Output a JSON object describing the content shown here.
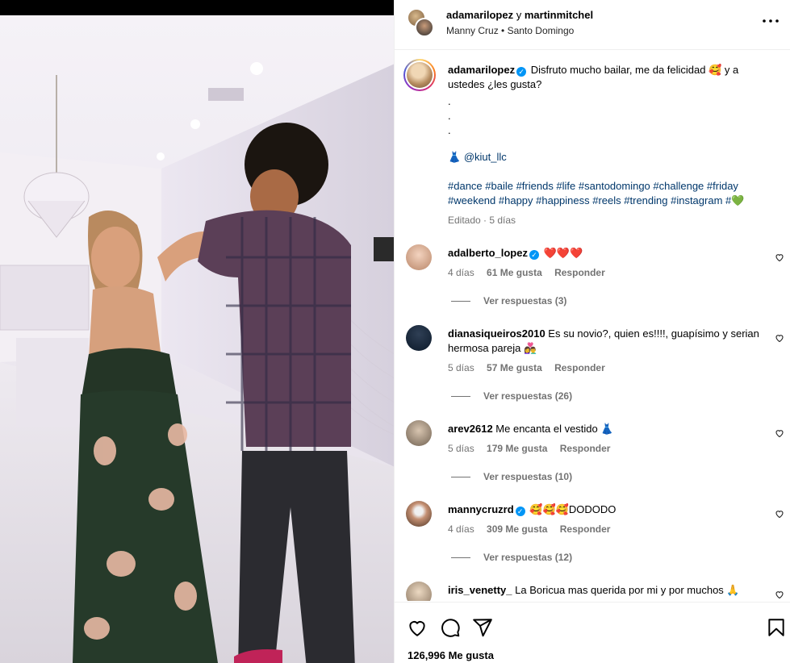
{
  "header": {
    "user1": "adamarilopez",
    "joiner": "y",
    "user2": "martinmitchel",
    "audio": "Manny Cruz",
    "separator": "•",
    "location": "Santo Domingo"
  },
  "caption": {
    "username": "adamarilopez",
    "text": "Disfruto mucho bailar, me da felicidad 🥰 y a ustedes ¿les gusta?",
    "dots": [
      ".",
      ".",
      "."
    ],
    "tag_emoji": "👗",
    "tag": "@kiut_llc",
    "hashtags": "#dance #baile #friends #life #santodomingo #challenge #friday #weekend #happy #happiness #reels #trending #instagram #💚",
    "meta": "Editado · 5 días"
  },
  "comments": [
    {
      "username": "adalberto_lopez",
      "verified": true,
      "text": "❤️❤️❤️",
      "time": "4 días",
      "likes": "61 Me gusta",
      "reply": "Responder",
      "replies": "Ver respuestas (3)"
    },
    {
      "username": "dianasiqueiros2010",
      "verified": false,
      "text": "Es su novio?, quien es!!!!, guapísimo y serian hermosa pareja 👩‍❤️‍👨",
      "time": "5 días",
      "likes": "57 Me gusta",
      "reply": "Responder",
      "replies": "Ver respuestas (26)"
    },
    {
      "username": "arev2612",
      "verified": false,
      "text": "Me encanta el vestido 👗",
      "time": "5 días",
      "likes": "179 Me gusta",
      "reply": "Responder",
      "replies": "Ver respuestas (10)"
    },
    {
      "username": "mannycruzrd",
      "verified": true,
      "text": "🥰🥰🥰DODODO",
      "time": "4 días",
      "likes": "309 Me gusta",
      "reply": "Responder",
      "replies": "Ver respuestas (12)"
    },
    {
      "username": "iris_venetty_",
      "verified": false,
      "text": "La Boricua mas querida por mi y por muchos 🙏"
    }
  ],
  "footer": {
    "likes": "126,996 Me gusta"
  },
  "icons": [
    "more-icon",
    "like-icon",
    "comment-icon",
    "share-icon",
    "save-icon",
    "verified-icon"
  ],
  "colors": {
    "verified": "#0095f6",
    "link": "#00376b",
    "secondary": "#737373"
  }
}
